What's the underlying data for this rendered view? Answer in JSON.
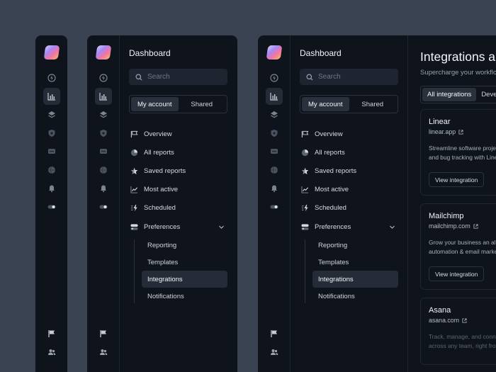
{
  "sidebar": {
    "title": "Dashboard",
    "search_placeholder": "Search",
    "segment": {
      "left": "My account",
      "right": "Shared",
      "selected": "My account"
    },
    "items": [
      {
        "label": "Overview",
        "icon": "flag-icon"
      },
      {
        "label": "All reports",
        "icon": "pie-chart-icon"
      },
      {
        "label": "Saved reports",
        "icon": "star-icon"
      },
      {
        "label": "Most active",
        "icon": "line-chart-icon"
      },
      {
        "label": "Scheduled",
        "icon": "bolt-icon"
      },
      {
        "label": "Preferences",
        "icon": "toggle-icon",
        "expanded": true
      }
    ],
    "subitems": [
      {
        "label": "Reporting"
      },
      {
        "label": "Templates"
      },
      {
        "label": "Integrations",
        "selected": true
      },
      {
        "label": "Notifications"
      }
    ]
  },
  "rail_icons": [
    "bolt-icon",
    "bar-chart-icon",
    "layers-icon",
    "shield-icon",
    "chat-icon",
    "globe-icon",
    "bell-icon",
    "toggle-icon",
    "flag-icon",
    "users-icon"
  ],
  "main": {
    "title": "Integrations a",
    "subtitle": "Supercharge your workflow",
    "tabs": [
      {
        "label": "All integrations",
        "selected": true
      },
      {
        "label": "Deve"
      }
    ],
    "cards": [
      {
        "name": "Linear",
        "url": "linear.app",
        "desc1": "Streamline software project",
        "desc2": "and bug tracking with Linea",
        "button": "View integration"
      },
      {
        "name": "Mailchimp",
        "url": "mailchimp.com",
        "desc1": "Grow your business an all-",
        "desc2": "automation & email marketi",
        "button": "View integration"
      },
      {
        "name": "Asana",
        "url": "asana.com",
        "desc1": "Track, manage, and connec",
        "desc2": "across any team, right from"
      }
    ]
  },
  "colors": {
    "background": "#3a4352",
    "panel": "#0e131c",
    "active": "#252c38"
  }
}
